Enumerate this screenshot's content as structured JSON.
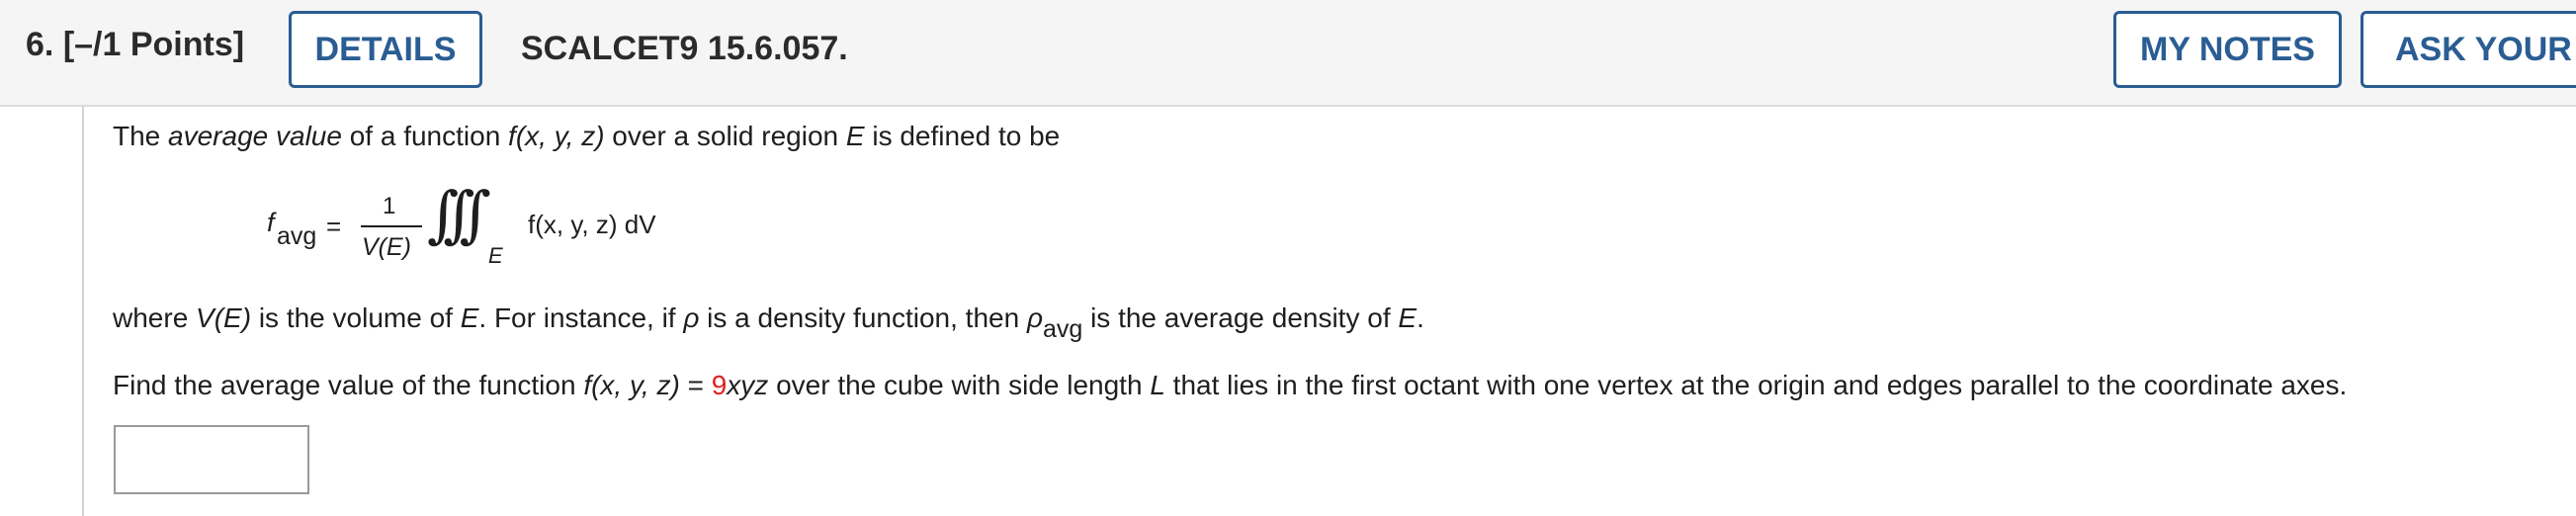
{
  "header": {
    "question_number": "6.",
    "points": "[–/1 Points]",
    "details_label": "DETAILS",
    "question_code": "SCALCET9 15.6.057.",
    "my_notes_label": "MY NOTES",
    "ask_teacher_label": "ASK YOUR T"
  },
  "problem": {
    "intro_a": "The ",
    "intro_em": "average value",
    "intro_b": " of a function ",
    "intro_func": "f(x, y, z)",
    "intro_c": " over a solid region ",
    "intro_E": "E",
    "intro_d": " is defined to be",
    "formula": {
      "lhs_f": "f",
      "lhs_sub": "avg",
      "equals": "=",
      "numerator": "1",
      "denominator": "V(E)",
      "integral_sign": "∫∫∫",
      "integral_region": "E",
      "integrand": "f(x, y, z) dV"
    },
    "where_a": "where ",
    "where_VE": "V(E)",
    "where_b": " is the volume of ",
    "where_E": "E",
    "where_c": ". For instance, if ",
    "where_rho": "ρ",
    "where_d": " is a density function, then ",
    "where_rho2": "ρ",
    "where_sub": "avg",
    "where_e": " is the average density of ",
    "where_E2": "E",
    "where_f": ".",
    "task_a": "Find the average value of the function ",
    "task_func": "f(x, y, z)",
    "task_eq": " = ",
    "task_coef": "9",
    "task_xyz": "xyz",
    "task_b": " over the cube with side length ",
    "task_L": "L",
    "task_c": " that lies in the first octant with one vertex at the origin and edges parallel to the coordinate axes."
  },
  "answer": {
    "value": ""
  },
  "colors": {
    "button_accent": "#2a5d93",
    "highlight_red": "#e02020",
    "header_bg": "#f5f5f5"
  }
}
